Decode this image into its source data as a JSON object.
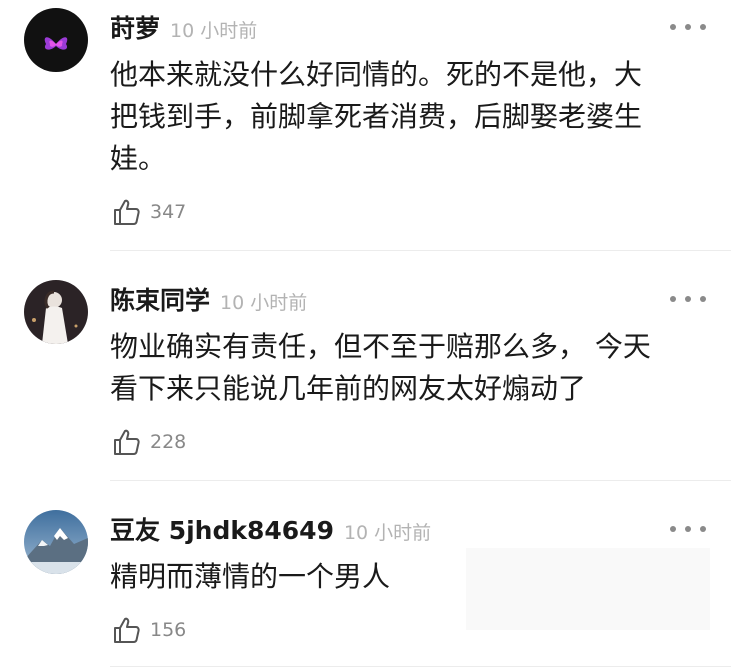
{
  "comments": [
    {
      "username": "莳萝",
      "time": "10 小时前",
      "lines": [
        "他本来就没什么好同情的。死的不是他，大",
        "把钱到手，前脚拿死者消费，后脚娶老婆生",
        "娃。"
      ],
      "likes": "347",
      "avatar_icon": "purple-butterfly-avatar"
    },
    {
      "username": "陈束同学",
      "time": "10 小时前",
      "lines": [
        "物业确实有责任，但不至于赔那么多，  今天",
        "看下来只能说几年前的网友太好煽动了"
      ],
      "likes": "228",
      "avatar_icon": "white-dress-person-avatar"
    },
    {
      "username": "豆友 5jhdk84649",
      "time": "10 小时前",
      "lines": [
        "精明而薄情的一个男人"
      ],
      "likes": "156",
      "avatar_icon": "snowy-mountain-avatar"
    }
  ],
  "icons": {
    "more": "more-dots-icon",
    "like": "thumbs-up-icon"
  },
  "colors": {
    "text": "#1a1a1a",
    "timestamp": "#b3b3b3",
    "like_count": "#888888",
    "divider": "#ececec"
  }
}
